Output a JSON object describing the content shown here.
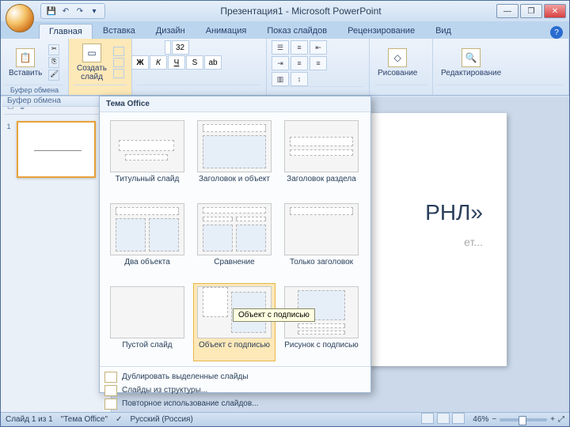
{
  "window": {
    "title": "Презентация1 - Microsoft PowerPoint"
  },
  "tabs": {
    "home": "Главная",
    "insert": "Вставка",
    "design": "Дизайн",
    "animations": "Анимация",
    "slideshow": "Показ слайдов",
    "review": "Рецензирование",
    "view": "Вид"
  },
  "ribbon": {
    "clipboard": {
      "label": "Буфер обмена",
      "paste": "Вставить"
    },
    "slides": {
      "newSlide": "Создать\nслайд"
    },
    "font": {
      "size": "32"
    },
    "drawing": {
      "label": "Рисование"
    },
    "editing": {
      "label": "Редактирование"
    }
  },
  "slide": {
    "titleFragment": "РНЛ»",
    "subtitleFragment": "ет..."
  },
  "status": {
    "slideInfo": "Слайд 1 из 1",
    "theme": "\"Тема Office\"",
    "lang": "Русский (Россия)",
    "zoom": "46%"
  },
  "gallery": {
    "header": "Тема Office",
    "items": [
      "Титульный слайд",
      "Заголовок и объект",
      "Заголовок раздела",
      "Два объекта",
      "Сравнение",
      "Только заголовок",
      "Пустой слайд",
      "Объект с подписью",
      "Рисунок с подписью"
    ],
    "tooltip": "Объект с подписью",
    "footer": {
      "duplicate": "Дублировать выделенные слайды",
      "outline": "Слайды из структуры...",
      "reuse": "Повторное использование слайдов..."
    }
  }
}
